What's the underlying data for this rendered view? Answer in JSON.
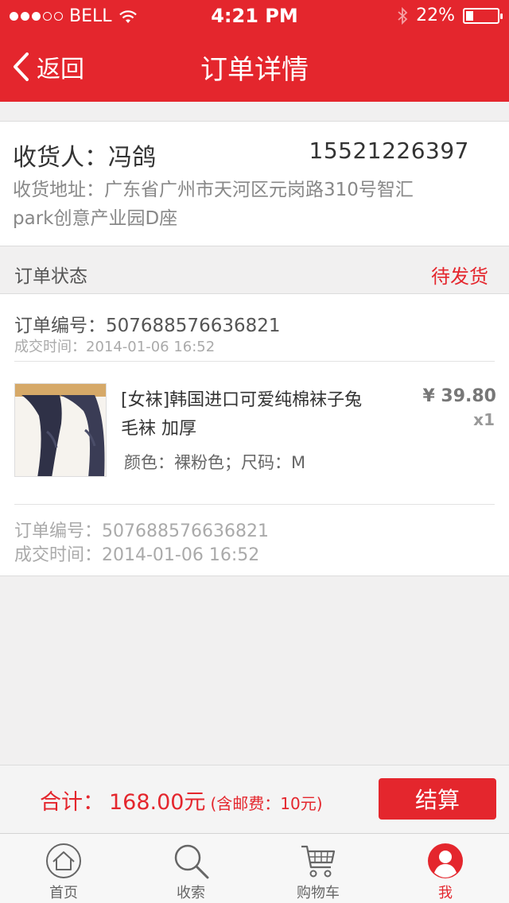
{
  "status_bar": {
    "carrier": "BELL",
    "time": "4:21 PM",
    "battery": "22%",
    "battery_level": 0.22
  },
  "nav": {
    "back_label": "返回",
    "title": "订单详情"
  },
  "address": {
    "receiver": "收货人：冯鸽",
    "phone": "15521226397",
    "address": "收货地址：广东省广州市天河区元岗路310号智汇park创意产业园D座"
  },
  "order_status": {
    "label": "订单状态",
    "value": "待发货"
  },
  "order": {
    "number": "订单编号：507688576636821",
    "time": "成交时间：2014-01-06  16:52",
    "product": {
      "title": "[女袜]韩国进口可爱纯棉袜子兔毛袜 加厚",
      "spec": "颜色：裸粉色；尺码：M",
      "price": "¥ 39.80",
      "qty": "x1"
    },
    "number_footer": "订单编号：507688576636821",
    "time_footer": "成交时间：2014-01-06   16:52"
  },
  "summary": {
    "label": "合计：",
    "amount": "168.00元",
    "note": "(含邮费：10元)",
    "checkout_label": "结算"
  },
  "tabbar": {
    "items": [
      {
        "label": "首页",
        "icon": "home-icon"
      },
      {
        "label": "收索",
        "icon": "search-icon"
      },
      {
        "label": "购物车",
        "icon": "cart-icon"
      },
      {
        "label": "我",
        "icon": "profile-icon"
      }
    ],
    "active_index": 3
  },
  "colors": {
    "brand_red": "#e4262d",
    "background": "#f1f0f0"
  }
}
